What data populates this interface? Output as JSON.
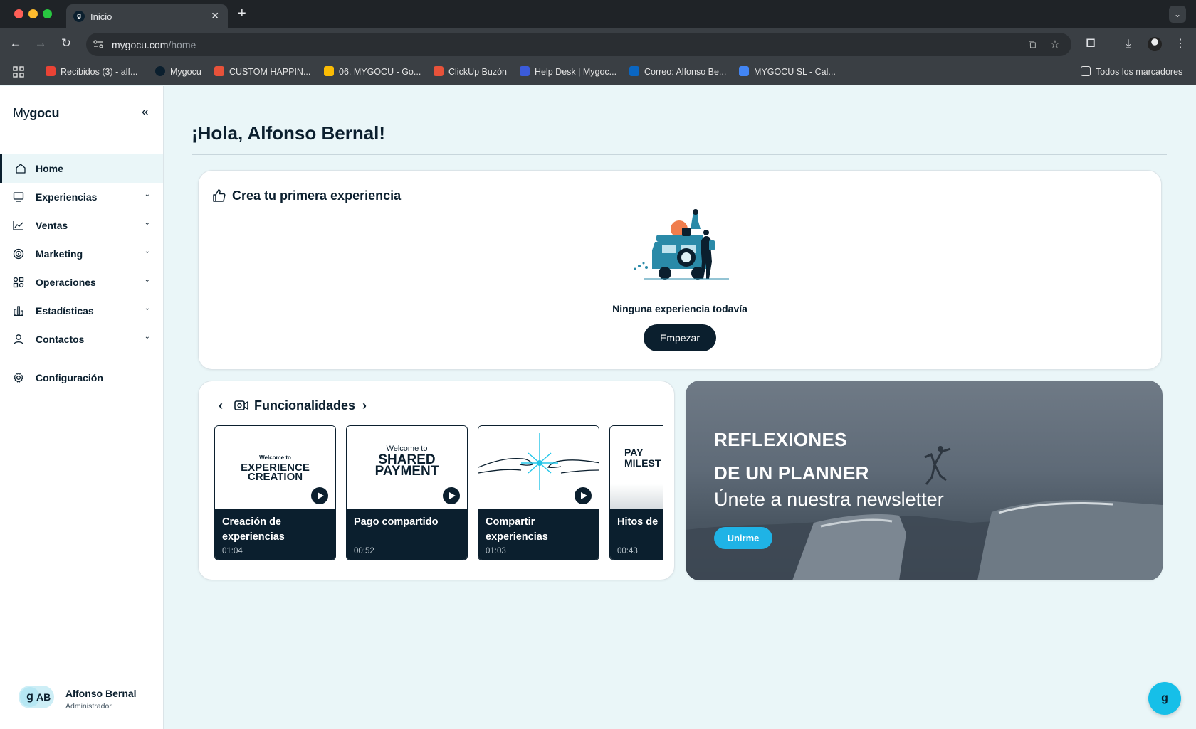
{
  "browser": {
    "tab_title": "Inicio",
    "tab_favicon": "g",
    "url_host": "mygocu.com",
    "url_path": "/home",
    "bookmarks": [
      {
        "label": "Recibidos (3) - alf...",
        "icon": "gmail-icon",
        "color": "#ea4335"
      },
      {
        "label": "Mygocu",
        "icon": "mygocu-icon",
        "color": "#0b1f2e"
      },
      {
        "label": "CUSTOM HAPPIN...",
        "icon": "clickup-icon",
        "color": "#e8523a"
      },
      {
        "label": "06. MYGOCU - Go...",
        "icon": "drive-icon",
        "color": "#fbbc04"
      },
      {
        "label": "ClickUp Buzón",
        "icon": "clickup-icon",
        "color": "#e8523a"
      },
      {
        "label": "Help Desk | Mygoc...",
        "icon": "helpdesk-icon",
        "color": "#3b5bdb"
      },
      {
        "label": "Correo: Alfonso Be...",
        "icon": "outlook-icon",
        "color": "#0a66c2"
      },
      {
        "label": "MYGOCU SL - Cal...",
        "icon": "calendar-icon",
        "color": "#4285f4"
      }
    ],
    "all_bookmarks_label": "Todos los marcadores"
  },
  "sidebar": {
    "brand_prefix": "My",
    "brand_bold": "gocu",
    "items": [
      {
        "label": "Home",
        "icon": "home-icon",
        "active": true,
        "has_submenu": false
      },
      {
        "label": "Experiencias",
        "icon": "monitor-icon",
        "has_submenu": true
      },
      {
        "label": "Ventas",
        "icon": "line-chart-icon",
        "has_submenu": true
      },
      {
        "label": "Marketing",
        "icon": "target-icon",
        "has_submenu": true
      },
      {
        "label": "Operaciones",
        "icon": "operations-icon",
        "has_submenu": true
      },
      {
        "label": "Estadísticas",
        "icon": "bar-chart-icon",
        "has_submenu": true
      },
      {
        "label": "Contactos",
        "icon": "user-icon",
        "has_submenu": true
      }
    ],
    "config_label": "Configuración",
    "user": {
      "initials": "AB",
      "logo_letter": "g",
      "name": "Alfonso Bernal",
      "role": "Administrador"
    }
  },
  "main": {
    "greeting": "¡Hola, Alfonso Bernal!",
    "experience_card": {
      "title": "Crea tu primera experiencia",
      "empty_text": "Ninguna experiencia todavía",
      "button": "Empezar"
    },
    "features": {
      "title": "Funcionalidades",
      "tiles": [
        {
          "thumb_small": "Welcome to",
          "thumb_big": "EXPERIENCE CREATION",
          "name": "Creación de experiencias",
          "duration": "01:04"
        },
        {
          "thumb_small": "Welcome to",
          "thumb_big": "SHARED PAYMENT",
          "name": "Pago compartido",
          "duration": "00:52"
        },
        {
          "thumb_small": "",
          "thumb_big": "",
          "name": "Compartir experiencias",
          "duration": "01:03"
        },
        {
          "thumb_small": "",
          "thumb_big": "PAY MILEST",
          "name": "Hitos de",
          "duration": "00:43"
        }
      ]
    },
    "newsletter": {
      "title_line1": "REFLEXIONES",
      "title_line2": "DE UN PLANNER",
      "subtitle": "Únete a nuestra newsletter",
      "button": "Unirme"
    },
    "fab_letter": "g"
  },
  "colors": {
    "primary": "#0b1f2e",
    "accent": "#16bfe8",
    "background": "#eaf6f8"
  }
}
